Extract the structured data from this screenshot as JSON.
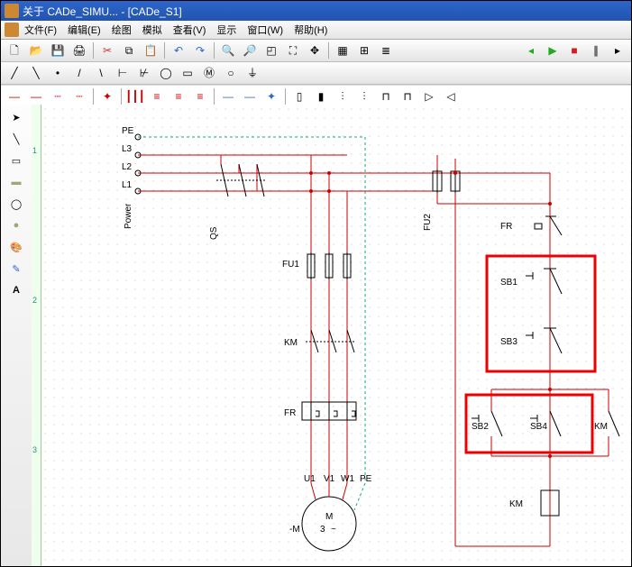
{
  "title": "关于 CADe_SIMU... - [CADe_S1]",
  "menu": {
    "file": "文件(F)",
    "edit": "编辑(E)",
    "draw": "绘图",
    "sim": "模拟",
    "view": "查看(V)",
    "display": "显示",
    "sheet": "窗口(W)",
    "help": "帮助(H)"
  },
  "ruler": {
    "m1": "1",
    "m2": "2",
    "m3": "3"
  },
  "labels": {
    "PE": "PE",
    "L3": "L3",
    "L2": "L2",
    "L1": "L1",
    "Power": "Power",
    "QS": "QS",
    "FU1": "FU1",
    "KM": "KM",
    "FR": "FR",
    "U1": "U1",
    "V1": "V1",
    "W1": "W1",
    "PE2": "PE",
    "M": "M",
    "three": "3",
    "minusM": "-M",
    "tilde": "~",
    "FU2": "FU2",
    "FRr": "FR",
    "SB1": "SB1",
    "SB3": "SB3",
    "SB2": "SB2",
    "SB4": "SB4",
    "KMr": "KM",
    "KMcoil": "KM"
  },
  "colors": {
    "accent": "#c00",
    "green": "#1a8",
    "play": "#2a2"
  }
}
